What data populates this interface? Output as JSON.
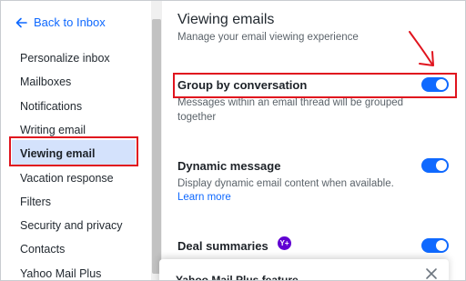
{
  "sidebar": {
    "back_label": "Back to Inbox",
    "items": [
      {
        "label": "Personalize inbox"
      },
      {
        "label": "Mailboxes"
      },
      {
        "label": "Notifications"
      },
      {
        "label": "Writing email"
      },
      {
        "label": "Viewing email"
      },
      {
        "label": "Vacation response"
      },
      {
        "label": "Filters"
      },
      {
        "label": "Security and privacy"
      },
      {
        "label": "Contacts"
      },
      {
        "label": "Yahoo Mail Plus"
      }
    ],
    "active_index": 4
  },
  "main": {
    "title": "Viewing emails",
    "subtitle": "Manage your email viewing experience",
    "settings": [
      {
        "title": "Group by conversation",
        "description": "Messages within an email thread will be grouped together",
        "enabled": true
      },
      {
        "title": "Dynamic message",
        "description": "Display dynamic email content when available.",
        "link": "Learn more",
        "enabled": true
      },
      {
        "title": "Deal summaries",
        "badge": "Y+",
        "enabled": true
      }
    ]
  },
  "popup": {
    "text": "Yahoo Mail Plus feature"
  },
  "colors": {
    "accent": "#0f69ff",
    "highlight": "#e0141e",
    "active_bg": "#d4e2fc",
    "plus_purple": "#6001d2"
  }
}
